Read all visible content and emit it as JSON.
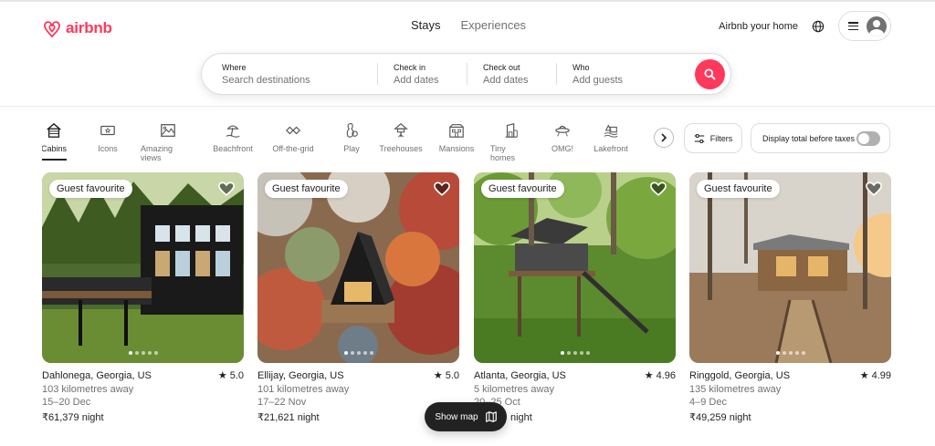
{
  "brand": {
    "name": "airbnb",
    "color": "#ff385c",
    "logo_icon": "airbnb-belo-icon"
  },
  "nav": {
    "tabs": [
      "Stays",
      "Experiences"
    ],
    "active": "Stays"
  },
  "header_right": {
    "host_link": "Airbnb your home",
    "globe_icon": "globe-icon",
    "menu_icon": "hamburger-icon",
    "avatar_icon": "user-avatar-icon"
  },
  "search": {
    "where_label": "Where",
    "where_placeholder": "Search destinations",
    "checkin_label": "Check in",
    "checkin_placeholder": "Add dates",
    "checkout_label": "Check out",
    "checkout_placeholder": "Add dates",
    "who_label": "Who",
    "who_placeholder": "Add guests",
    "button_icon": "search-icon"
  },
  "categories": [
    {
      "label": "Cabins",
      "icon": "cabin-icon",
      "active": true
    },
    {
      "label": "Icons",
      "icon": "ticket-icon"
    },
    {
      "label": "Amazing views",
      "icon": "view-icon"
    },
    {
      "label": "Beachfront",
      "icon": "beach-icon"
    },
    {
      "label": "Off-the-grid",
      "icon": "diamond-icon"
    },
    {
      "label": "Play",
      "icon": "bowling-icon"
    },
    {
      "label": "Treehouses",
      "icon": "treehouse-icon"
    },
    {
      "label": "Mansions",
      "icon": "mansion-icon"
    },
    {
      "label": "Tiny homes",
      "icon": "tiny-home-icon"
    },
    {
      "label": "OMG!",
      "icon": "ufo-icon"
    },
    {
      "label": "Lakefront",
      "icon": "lake-icon"
    }
  ],
  "filters": {
    "label": "Filters",
    "icon": "sliders-icon"
  },
  "tax_toggle": {
    "label": "Display total before taxes",
    "on": false
  },
  "listings": [
    {
      "badge": "Guest favourite",
      "location": "Dahlonega, Georgia, US",
      "rating": "5.0",
      "distance": "103 kilometres away",
      "dates": "15–20 Dec",
      "price": "₹61,379",
      "price_unit": " night"
    },
    {
      "badge": "Guest favourite",
      "location": "Ellijay, Georgia, US",
      "rating": "5.0",
      "distance": "101 kilometres away",
      "dates": "17–22 Nov",
      "price": "₹21,621",
      "price_unit": " night"
    },
    {
      "badge": "Guest favourite",
      "location": "Atlanta, Georgia, US",
      "rating": "4.96",
      "distance": "5 kilometres away",
      "dates": "20–25 Oct",
      "price": "",
      "price_unit": "night"
    },
    {
      "badge": "Guest favourite",
      "location": "Ringgold, Georgia, US",
      "rating": "4.99",
      "distance": "135 kilometres away",
      "dates": "4–9 Dec",
      "price": "₹49,259",
      "price_unit": " night"
    }
  ],
  "show_map": {
    "label": "Show map",
    "icon": "map-icon"
  }
}
